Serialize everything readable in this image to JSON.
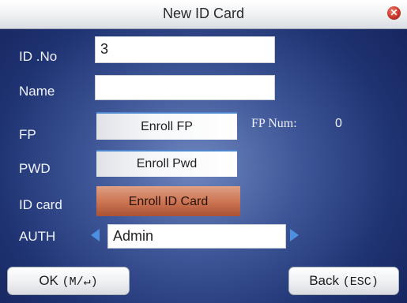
{
  "window": {
    "title": "New ID Card"
  },
  "form": {
    "id_no": {
      "label": "ID .No",
      "value": "3"
    },
    "name": {
      "label": "Name",
      "value": ""
    },
    "fp": {
      "label": "FP",
      "button": "Enroll FP",
      "num_label": "FP Num:",
      "num_value": "0"
    },
    "pwd": {
      "label": "PWD",
      "button": "Enroll Pwd"
    },
    "idcard": {
      "label": "ID card",
      "button": "Enroll ID Card"
    },
    "auth": {
      "label": "AUTH",
      "value": "Admin"
    }
  },
  "footer": {
    "ok": {
      "text": "OK",
      "hint": "(M/↵)"
    },
    "back": {
      "text": "Back",
      "hint": "(ESC)"
    }
  },
  "colors": {
    "active_button": "#c9714f",
    "accent": "#4d8fe0",
    "background": "#2b4283"
  }
}
